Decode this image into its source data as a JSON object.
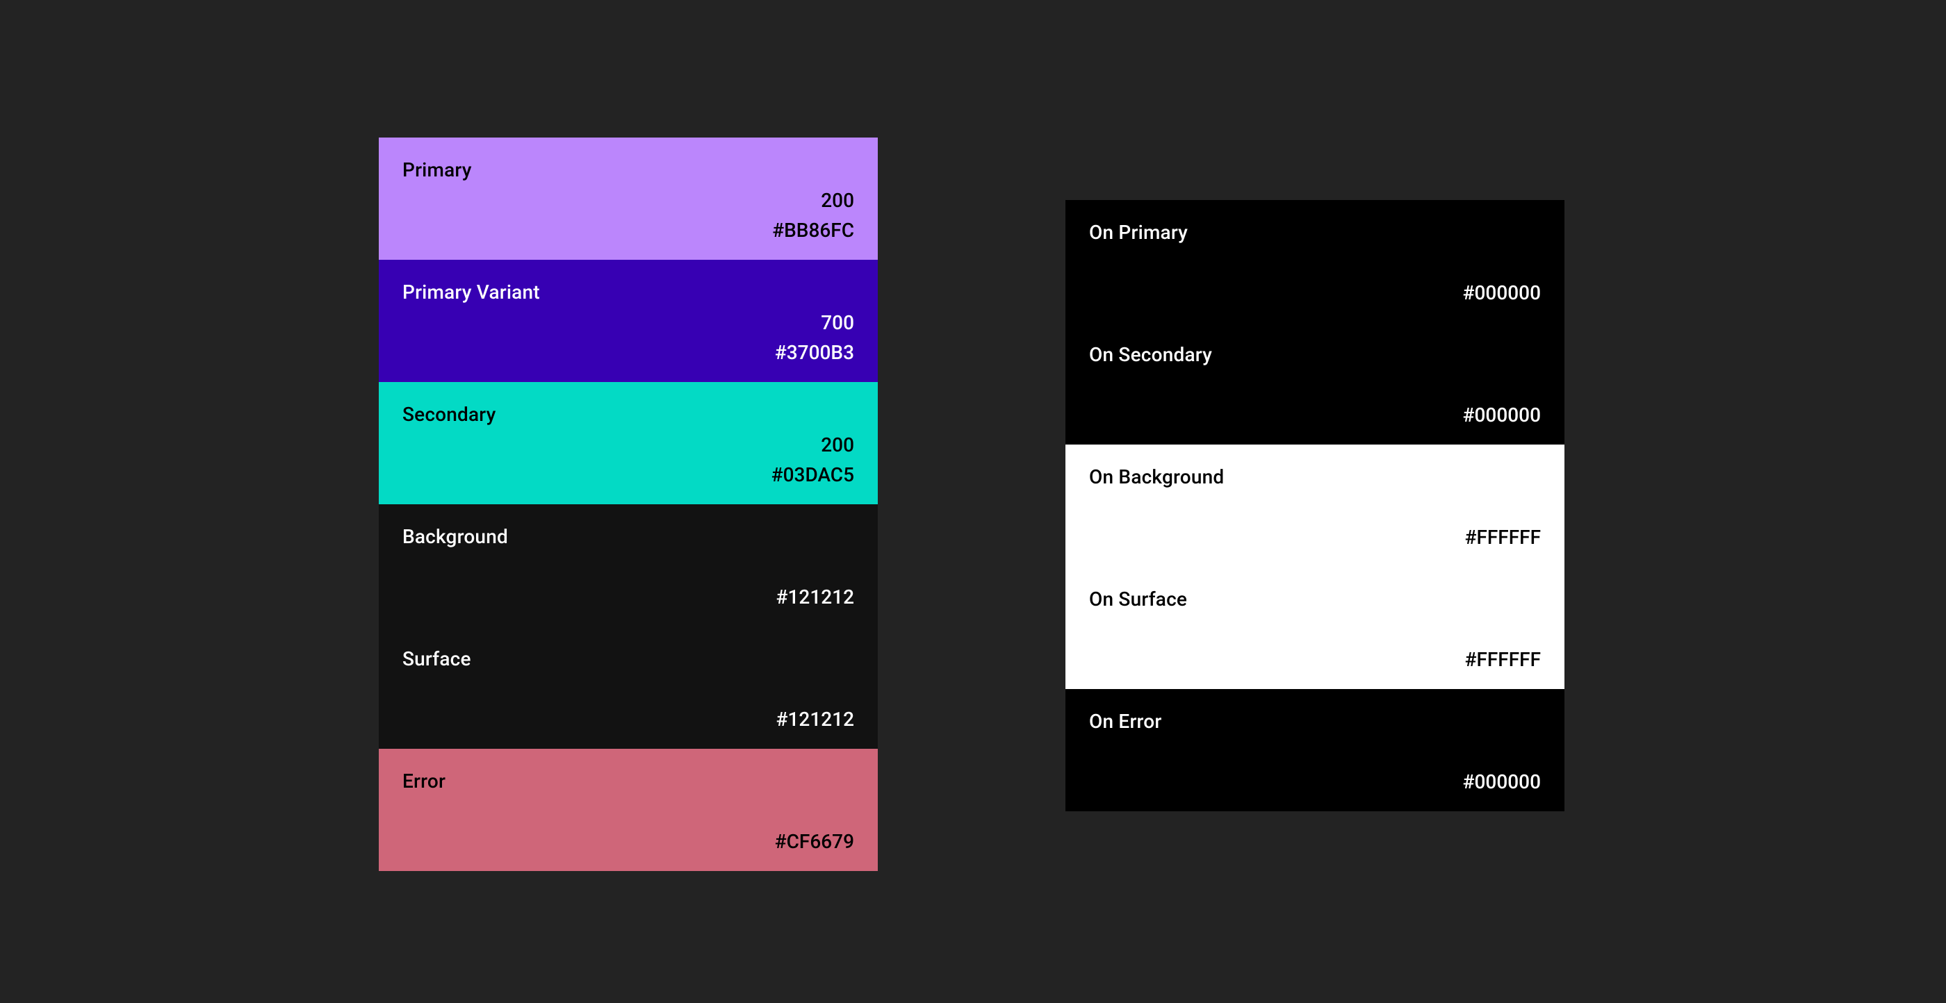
{
  "leftPalette": [
    {
      "label": "Primary",
      "tone": "200",
      "hex": "#BB86FC",
      "bg": "#BB86FC",
      "textClass": "text-dark"
    },
    {
      "label": "Primary Variant",
      "tone": "700",
      "hex": "#3700B3",
      "bg": "#3700B3",
      "textClass": "text-light"
    },
    {
      "label": "Secondary",
      "tone": "200",
      "hex": "#03DAC5",
      "bg": "#03DAC5",
      "textClass": "text-dark"
    },
    {
      "label": "Background",
      "tone": "",
      "hex": "#121212",
      "bg": "#121212",
      "textClass": "text-light"
    },
    {
      "label": "Surface",
      "tone": "",
      "hex": "#121212",
      "bg": "#121212",
      "textClass": "text-light"
    },
    {
      "label": "Error",
      "tone": "",
      "hex": "#CF6679",
      "bg": "#CF6679",
      "textClass": "text-dark"
    }
  ],
  "rightPalette": [
    {
      "label": "On Primary",
      "hex": "#000000",
      "bg": "#000000",
      "textClass": "text-light"
    },
    {
      "label": "On Secondary",
      "hex": "#000000",
      "bg": "#000000",
      "textClass": "text-light"
    },
    {
      "label": "On Background",
      "hex": "#FFFFFF",
      "bg": "#FFFFFF",
      "textClass": "text-dark"
    },
    {
      "label": "On Surface",
      "hex": "#FFFFFF",
      "bg": "#FFFFFF",
      "textClass": "text-dark"
    },
    {
      "label": "On Error",
      "hex": "#000000",
      "bg": "#000000",
      "textClass": "text-light"
    }
  ]
}
